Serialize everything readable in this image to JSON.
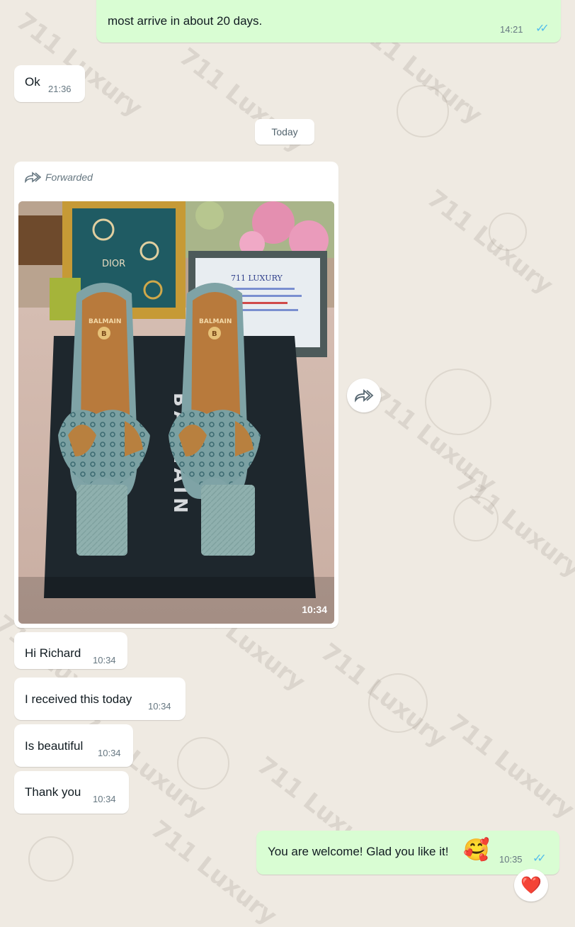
{
  "messages": {
    "top_out": {
      "text": "most arrive in about 20 days.",
      "time": "14:21"
    },
    "ok": {
      "text": "Ok",
      "time": "21:36"
    },
    "forwarded": {
      "label": "Forwarded",
      "time": "10:34"
    },
    "hi": {
      "text": "Hi Richard",
      "time": "10:34"
    },
    "received": {
      "text": "I received this today",
      "time": "10:34"
    },
    "beautiful": {
      "text": "Is beautiful",
      "time": "10:34"
    },
    "thanks": {
      "text": "Thank you",
      "time": "10:34"
    },
    "welcome": {
      "text": "You are welcome! Glad you like it!",
      "emoji": "🥰",
      "time": "10:35",
      "reaction": "❤️"
    }
  },
  "date_chip": "Today",
  "photo": {
    "box_brand": "BALMAIN",
    "insole_brand": "BALMAIN",
    "insole_monogram": "B",
    "card_title": "711 LUXURY",
    "perfume_brand": "DIOR"
  },
  "watermark": "711 Luxury",
  "colors": {
    "outgoing": "#d9fdd3",
    "incoming": "#ffffff",
    "read_ticks": "#53bdeb",
    "background": "#efeae2"
  }
}
